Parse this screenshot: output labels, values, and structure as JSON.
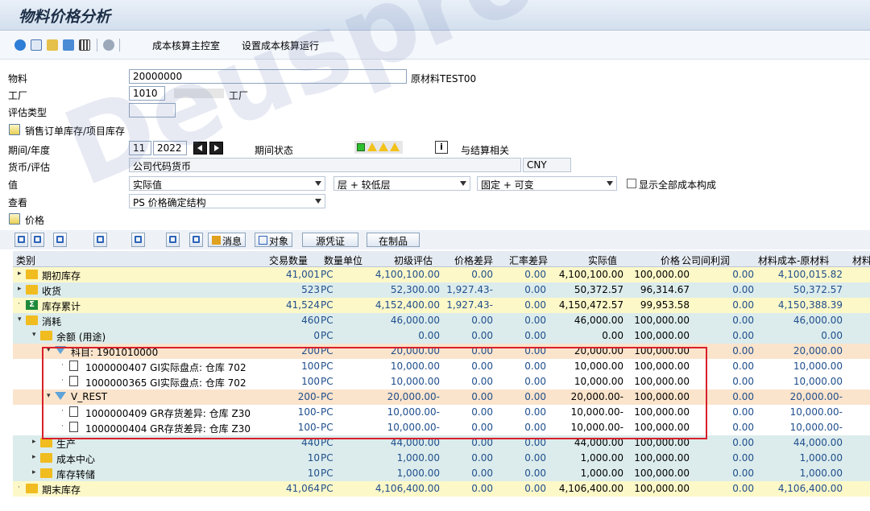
{
  "app": {
    "title": "物料价格分析"
  },
  "toolbar": {
    "btn1": "成本核算主控室",
    "btn2": "设置成本核算运行"
  },
  "form": {
    "material_label": "物料",
    "material_value": "20000000",
    "material_desc": "原材料TEST00",
    "plant_label": "工厂",
    "plant_value": "1010",
    "plant_desc": "工厂",
    "valtype_label": "评估类型",
    "sales_order_stock": "销售订单库存/项目库存",
    "period_label": "期间/年度",
    "period_value": "11",
    "year_value": "2022",
    "period_status_label": "期间状态",
    "settlement_label": "与结算相关",
    "currency_label": "货币/评估",
    "currency_value": "公司代码货币",
    "currency_code": "CNY",
    "value_label": "值",
    "value_select": "实际值",
    "level_select": "层 + 较低层",
    "fixvar_select": "固定 + 可变",
    "show_all_label": "显示全部成本构成",
    "view_label": "查看",
    "view_select": "PS 价格确定结构",
    "price_section": "价格"
  },
  "grid_toolbar": {
    "msg": "消息",
    "obj": "对象",
    "src": "源凭证",
    "wip": "在制品"
  },
  "columns": [
    "类别",
    "交易数量",
    "数量单位",
    "初级评估",
    "价格差异",
    "汇率差异",
    "实际值",
    "价格",
    "公司间利润",
    "材料成本-原材料",
    "材料"
  ],
  "rows": [
    {
      "level": 0,
      "icon": "folder",
      "caret": "▸",
      "label": "期初库存",
      "qty": "41,001",
      "unit": "PC",
      "prim": "4,100,100.00",
      "pvar": "0.00",
      "fx": "0.00",
      "actual": "4,100,100.00",
      "price": "100,000.00",
      "ic": "0.00",
      "mat": "4,100,015.82",
      "bg": "#fdf8c8"
    },
    {
      "level": 0,
      "icon": "folder",
      "caret": "▸",
      "label": "收货",
      "qty": "523",
      "unit": "PC",
      "prim": "52,300.00",
      "pvar": "1,927.43-",
      "fx": "0.00",
      "actual": "50,372.57",
      "price": "96,314.67",
      "ic": "0.00",
      "mat": "50,372.57",
      "bg": "#dcecec"
    },
    {
      "level": 0,
      "icon": "sum",
      "caret": "·",
      "label": "库存累计",
      "qty": "41,524",
      "unit": "PC",
      "prim": "4,152,400.00",
      "pvar": "1,927.43-",
      "fx": "0.00",
      "actual": "4,150,472.57",
      "price": "99,953.58",
      "ic": "0.00",
      "mat": "4,150,388.39",
      "bg": "#fdf8c8"
    },
    {
      "level": 0,
      "icon": "folder",
      "caret": "▾",
      "label": "消耗",
      "qty": "460",
      "unit": "PC",
      "prim": "46,000.00",
      "pvar": "0.00",
      "fx": "0.00",
      "actual": "46,000.00",
      "price": "100,000.00",
      "ic": "0.00",
      "mat": "46,000.00",
      "bg": "#dcecec"
    },
    {
      "level": 1,
      "icon": "folder",
      "caret": "▾",
      "label": "余额 (用途)",
      "qty": "0",
      "unit": "PC",
      "prim": "0.00",
      "pvar": "0.00",
      "fx": "0.00",
      "actual": "0.00",
      "price": "100,000.00",
      "ic": "0.00",
      "mat": "0.00",
      "bg": "#dcecec"
    },
    {
      "level": 2,
      "icon": "funnel",
      "caret": "▾",
      "label": "科目: 1901010000",
      "qty": "200",
      "unit": "PC",
      "prim": "20,000.00",
      "pvar": "0.00",
      "fx": "0.00",
      "actual": "20,000.00",
      "price": "100,000.00",
      "ic": "0.00",
      "mat": "20,000.00",
      "bg": "#fbe4cc"
    },
    {
      "level": 3,
      "icon": "doc",
      "caret": "·",
      "label": "1000000407 GI实际盘点: 仓库 702",
      "qty": "100",
      "unit": "PC",
      "prim": "10,000.00",
      "pvar": "0.00",
      "fx": "0.00",
      "actual": "10,000.00",
      "price": "100,000.00",
      "ic": "0.00",
      "mat": "10,000.00",
      "bg": "#ffffff"
    },
    {
      "level": 3,
      "icon": "doc",
      "caret": "·",
      "label": "1000000365 GI实际盘点: 仓库 702",
      "qty": "100",
      "unit": "PC",
      "prim": "10,000.00",
      "pvar": "0.00",
      "fx": "0.00",
      "actual": "10,000.00",
      "price": "100,000.00",
      "ic": "0.00",
      "mat": "10,000.00",
      "bg": "#ffffff"
    },
    {
      "level": 2,
      "icon": "funnel",
      "caret": "▾",
      "label": "V_REST",
      "qty": "200-",
      "unit": "PC",
      "prim": "20,000.00-",
      "pvar": "0.00",
      "fx": "0.00",
      "actual": "20,000.00-",
      "price": "100,000.00",
      "ic": "0.00",
      "mat": "20,000.00-",
      "bg": "#fbe4cc"
    },
    {
      "level": 3,
      "icon": "doc",
      "caret": "·",
      "label": "1000000409 GR存货差异: 仓库 Z30",
      "qty": "100-",
      "unit": "PC",
      "prim": "10,000.00-",
      "pvar": "0.00",
      "fx": "0.00",
      "actual": "10,000.00-",
      "price": "100,000.00",
      "ic": "0.00",
      "mat": "10,000.00-",
      "bg": "#ffffff"
    },
    {
      "level": 3,
      "icon": "doc",
      "caret": "·",
      "label": "1000000404 GR存货差异: 仓库 Z30",
      "qty": "100-",
      "unit": "PC",
      "prim": "10,000.00-",
      "pvar": "0.00",
      "fx": "0.00",
      "actual": "10,000.00-",
      "price": "100,000.00",
      "ic": "0.00",
      "mat": "10,000.00-",
      "bg": "#ffffff"
    },
    {
      "level": 1,
      "icon": "folder",
      "caret": "▸",
      "label": "生产",
      "qty": "440",
      "unit": "PC",
      "prim": "44,000.00",
      "pvar": "0.00",
      "fx": "0.00",
      "actual": "44,000.00",
      "price": "100,000.00",
      "ic": "0.00",
      "mat": "44,000.00",
      "bg": "#dcecec"
    },
    {
      "level": 1,
      "icon": "folder",
      "caret": "▸",
      "label": "成本中心",
      "qty": "10",
      "unit": "PC",
      "prim": "1,000.00",
      "pvar": "0.00",
      "fx": "0.00",
      "actual": "1,000.00",
      "price": "100,000.00",
      "ic": "0.00",
      "mat": "1,000.00",
      "bg": "#dcecec"
    },
    {
      "level": 1,
      "icon": "folder",
      "caret": "▸",
      "label": "库存转储",
      "qty": "10",
      "unit": "PC",
      "prim": "1,000.00",
      "pvar": "0.00",
      "fx": "0.00",
      "actual": "1,000.00",
      "price": "100,000.00",
      "ic": "0.00",
      "mat": "1,000.00",
      "bg": "#dcecec"
    },
    {
      "level": 0,
      "icon": "folder",
      "caret": "·",
      "label": "期末库存",
      "qty": "41,064",
      "unit": "PC",
      "prim": "4,106,400.00",
      "pvar": "0.00",
      "fx": "0.00",
      "actual": "4,106,400.00",
      "price": "100,000.00",
      "ic": "0.00",
      "mat": "4,106,400.00",
      "bg": "#fdf8c8"
    }
  ],
  "watermark": "Deusprocopyright",
  "colors": {
    "accent": "#1f4e8c",
    "highlight": "#d8202a"
  }
}
